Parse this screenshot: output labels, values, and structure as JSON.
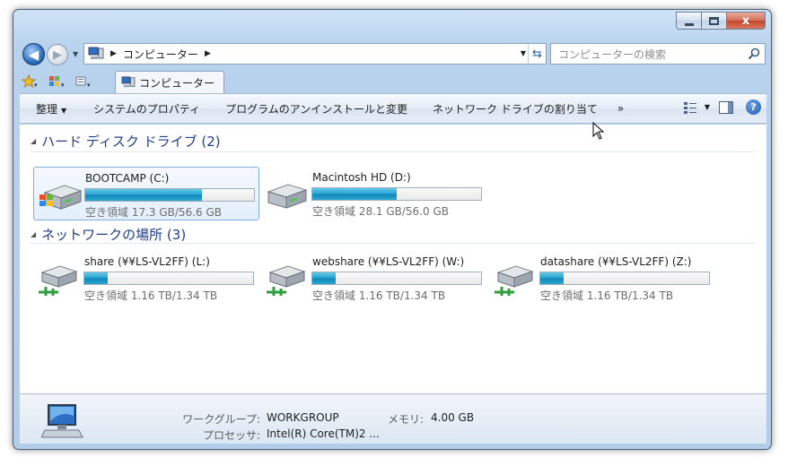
{
  "window": {
    "caption_buttons": {
      "minimize": "minimize",
      "maximize": "maximize",
      "close": "x"
    }
  },
  "address": {
    "location": "コンピューター",
    "search_placeholder": "コンピューターの検索"
  },
  "favorites_bar": {
    "tab_label": "コンピューター"
  },
  "command_bar": {
    "organize": "整理",
    "system_properties": "システムのプロパティ",
    "uninstall": "プログラムのアンインストールと変更",
    "map_drive": "ネットワーク ドライブの割り当て",
    "more": "»"
  },
  "groups": {
    "hard_disks": {
      "title": "ハード ディスク ドライブ (2)",
      "drives": [
        {
          "name": "BOOTCAMP (C:)",
          "free": "空き領域 17.3 GB/56.6 GB",
          "used_fraction": 0.69,
          "icon": "windows-drive-icon"
        },
        {
          "name": "Macintosh HD (D:)",
          "free": "空き領域 28.1 GB/56.0 GB",
          "used_fraction": 0.5,
          "icon": "hard-drive-icon"
        }
      ]
    },
    "network": {
      "title": "ネットワークの場所 (3)",
      "drives": [
        {
          "name": "share (¥¥LS-VL2FF) (L:)",
          "free": "空き領域 1.16 TB/1.34 TB",
          "used_fraction": 0.14,
          "icon": "network-drive-icon"
        },
        {
          "name": "webshare (¥¥LS-VL2FF) (W:)",
          "free": "空き領域 1.16 TB/1.34 TB",
          "used_fraction": 0.14,
          "icon": "network-drive-icon"
        },
        {
          "name": "datashare (¥¥LS-VL2FF) (Z:)",
          "free": "空き領域 1.16 TB/1.34 TB",
          "used_fraction": 0.14,
          "icon": "network-drive-icon"
        }
      ]
    }
  },
  "details": {
    "workgroup_label": "ワークグループ:",
    "workgroup_value": "WORKGROUP",
    "memory_label": "メモリ:",
    "memory_value": "4.00 GB",
    "processor_label": "プロセッサ:",
    "processor_value": "Intel(R) Core(TM)2 ..."
  },
  "colors": {
    "accent": "#1f3f8a",
    "bar_fill": "#26a0d0",
    "frame": "#b9d3ee"
  }
}
